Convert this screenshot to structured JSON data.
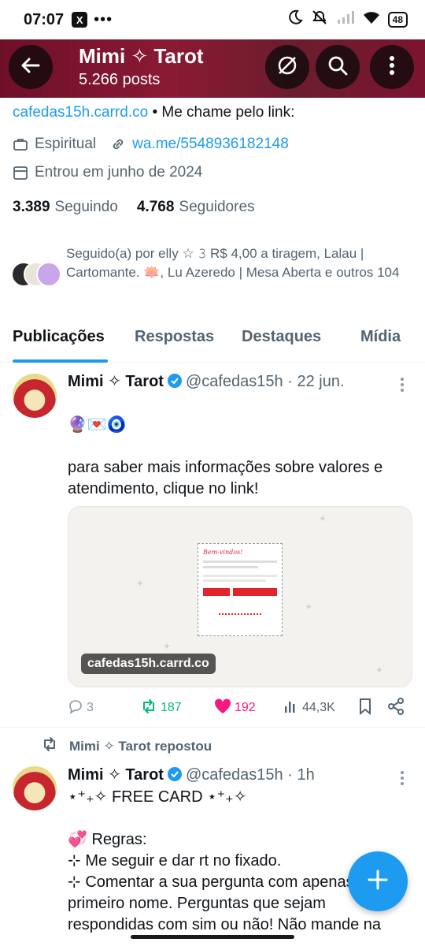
{
  "status_bar": {
    "time": "07:07",
    "x_badge": "X",
    "dots": "•••",
    "battery": "48",
    "icons": [
      "moon-icon",
      "mute-icon",
      "signal-icon",
      "wifi-icon",
      "battery-icon"
    ]
  },
  "header": {
    "name": "Mimi ✧ Tarot",
    "posts": "5.266 posts",
    "icons": [
      "back-arrow-icon",
      "grok-icon",
      "search-icon",
      "more-vertical-icon"
    ]
  },
  "profile": {
    "bio_link": "cafedas15h.carrd.co",
    "bio_rest": " • Me chame pelo link:",
    "category": "Espiritual",
    "website": "wa.me/5548936182148",
    "joined": "Entrou em junho de 2024",
    "following_count": "3.389",
    "following_label": "Seguindo",
    "followers_count": "4.768",
    "followers_label": "Seguidores",
    "followed_by": "Seguido(a) por elly ☆ 𝟹 R$ 4,00 a tiragem, Lalau | Cartomante. 🪷, Lu Azeredo | Mesa Aberta e outros 104"
  },
  "tabs": [
    {
      "label": "Publicações"
    },
    {
      "label": "Respostas"
    },
    {
      "label": "Destaques"
    },
    {
      "label": "Mídia"
    }
  ],
  "tweet1": {
    "name": "Mimi ✧ Tarot",
    "handle": "@cafedas15h",
    "time": "· 22 jun.",
    "emojis": "🔮💌🧿",
    "text": "para saber mais informações sobre valores e atendimento, clique no link!",
    "card_url": "cafedas15h.carrd.co",
    "card_title": "Bem-vindos!",
    "replies": "3",
    "reposts": "187",
    "likes": "192",
    "views": "44,3K"
  },
  "repost_label": "Mimi ✧ Tarot repostou",
  "tweet2": {
    "name": "Mimi ✧ Tarot",
    "handle": "@cafedas15h",
    "time": "· 1h",
    "line1": "⋆⁺₊✧ FREE CARD ⋆⁺₊✧",
    "line2": "💞 Regras:",
    "line3": "⊹ Me seguir e dar rt no fixado.",
    "line4": "⊹ Comentar a sua pergunta com apenas o primeiro nome. Perguntas que sejam respondidas com sim ou não! Não mande na"
  },
  "colors": {
    "accent": "#1d9bf0",
    "header": "#7c1430",
    "like": "#f91880",
    "repost": "#00ba7c"
  }
}
